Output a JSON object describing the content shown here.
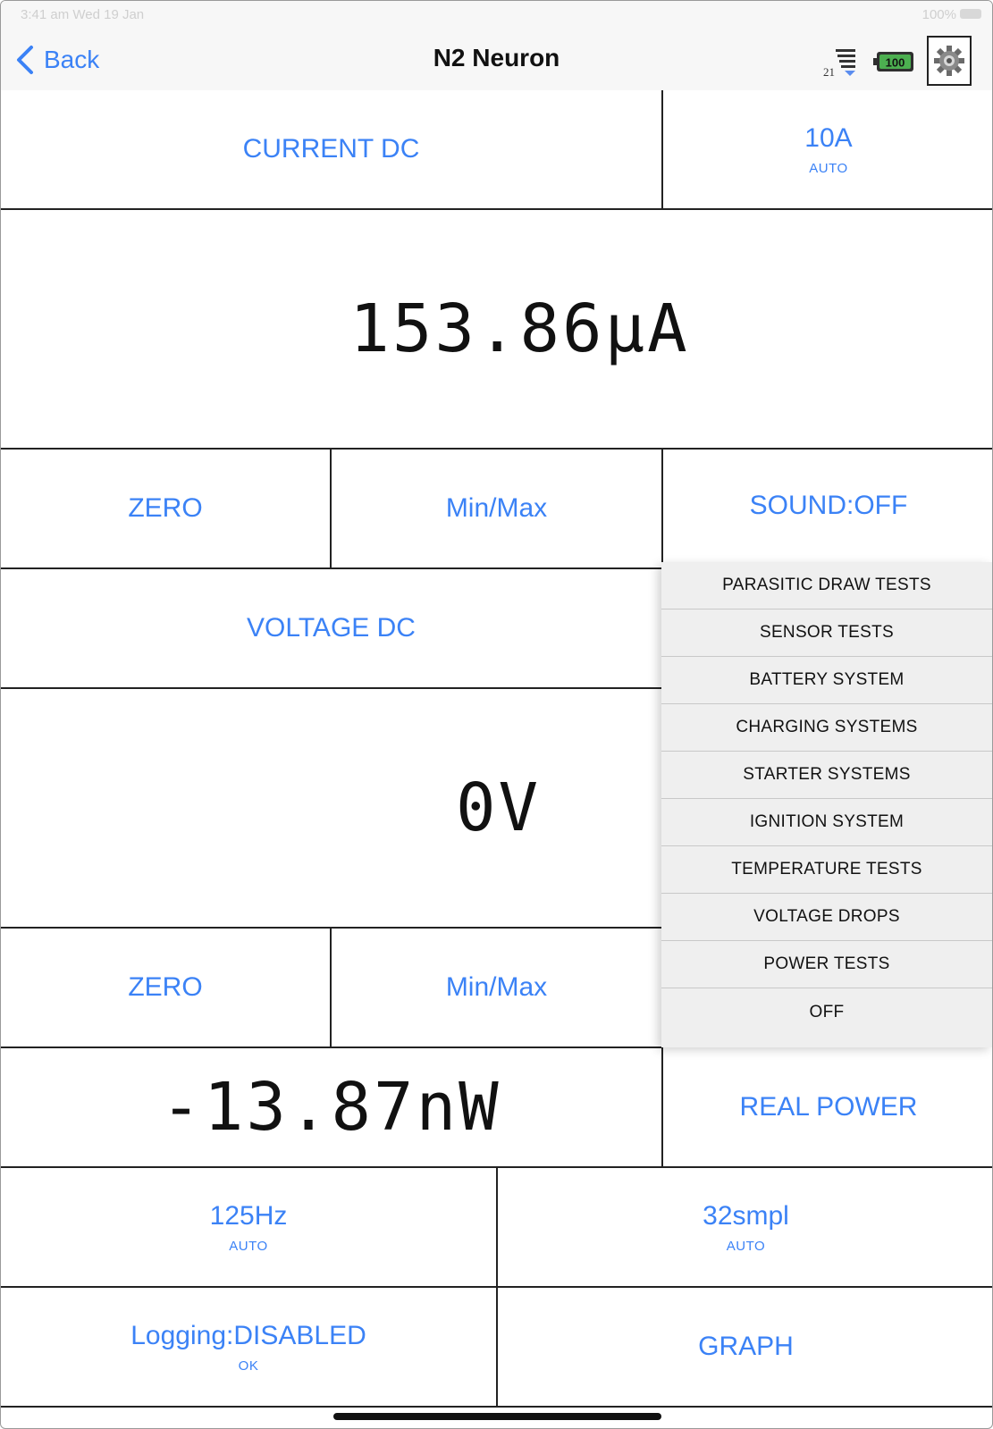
{
  "status_bar": {
    "time": "3:41 am  Wed 19 Jan",
    "battery": "100%"
  },
  "nav": {
    "back_label": "Back",
    "title": "N2 Neuron",
    "signal_label": "21",
    "battery_label": "100"
  },
  "current": {
    "mode_label": "CURRENT DC",
    "range_value": "10A",
    "range_sub": "AUTO",
    "reading": "153.86μA",
    "zero_label": "ZERO",
    "minmax_label": "Min/Max",
    "sound_label": "SOUND:OFF"
  },
  "voltage": {
    "mode_label": "VOLTAGE DC",
    "reading": "0V",
    "zero_label": "ZERO",
    "minmax_label": "Min/Max"
  },
  "power": {
    "reading": "-13.87nW",
    "mode_label": "REAL POWER"
  },
  "sampling": {
    "rate_value": "125Hz",
    "rate_sub": "AUTO",
    "samples_value": "32smpl",
    "samples_sub": "AUTO"
  },
  "logging": {
    "label": "Logging:DISABLED",
    "sub": "OK",
    "graph_label": "GRAPH"
  },
  "menu": {
    "items": [
      "PARASITIC DRAW TESTS",
      "SENSOR TESTS",
      "BATTERY SYSTEM",
      "CHARGING SYSTEMS",
      "STARTER SYSTEMS",
      "IGNITION SYSTEM",
      "TEMPERATURE TESTS",
      "VOLTAGE DROPS",
      "POWER TESTS",
      "OFF"
    ]
  },
  "colors": {
    "accent": "#3b82f6",
    "grid": "#222222",
    "menu_bg": "#efefef"
  }
}
